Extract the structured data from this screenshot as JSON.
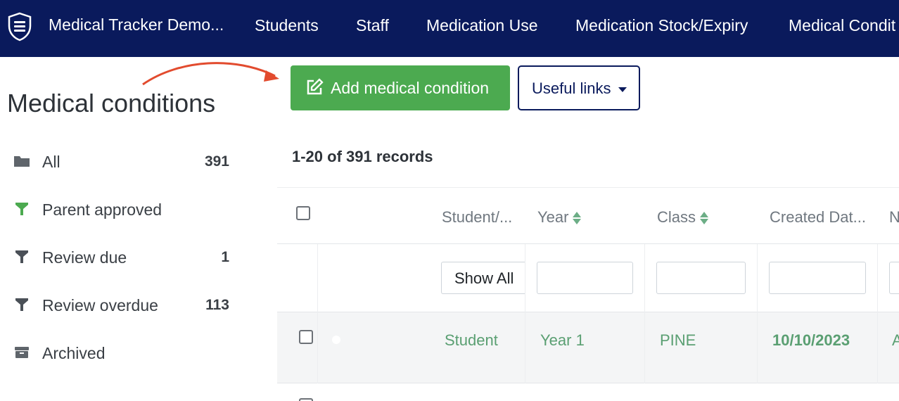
{
  "nav": {
    "brand": "Medical Tracker Demo...",
    "items": [
      "Students",
      "Staff",
      "Medication Use",
      "Medication Stock/Expiry",
      "Medical Condit"
    ]
  },
  "sidebar": {
    "title": "Medical conditions",
    "items": [
      {
        "label": "All",
        "count": "391",
        "icon": "folder-icon"
      },
      {
        "label": "Parent approved",
        "count": "",
        "icon": "filter-icon"
      },
      {
        "label": "Review due",
        "count": "1",
        "icon": "filter-icon"
      },
      {
        "label": "Review overdue",
        "count": "113",
        "icon": "filter-icon"
      },
      {
        "label": "Archived",
        "count": "",
        "icon": "archive-icon"
      }
    ]
  },
  "toolbar": {
    "add_label": "Add medical condition",
    "links_label": "Useful links"
  },
  "records": "1-20 of 391 records",
  "table": {
    "columns": [
      "Student/...",
      "Year",
      "Class",
      "Created Dat...",
      "N"
    ],
    "filter_select": "Show All",
    "rows": [
      {
        "student": "Student",
        "year": "Year 1",
        "class": "PINE",
        "created": "10/10/2023",
        "next": "A"
      }
    ]
  },
  "colors": {
    "nav_bg": "#0a1a5c",
    "primary_green": "#4caa50",
    "accent_green": "#5a9f72",
    "annotation_arrow": "#e24b2e"
  }
}
